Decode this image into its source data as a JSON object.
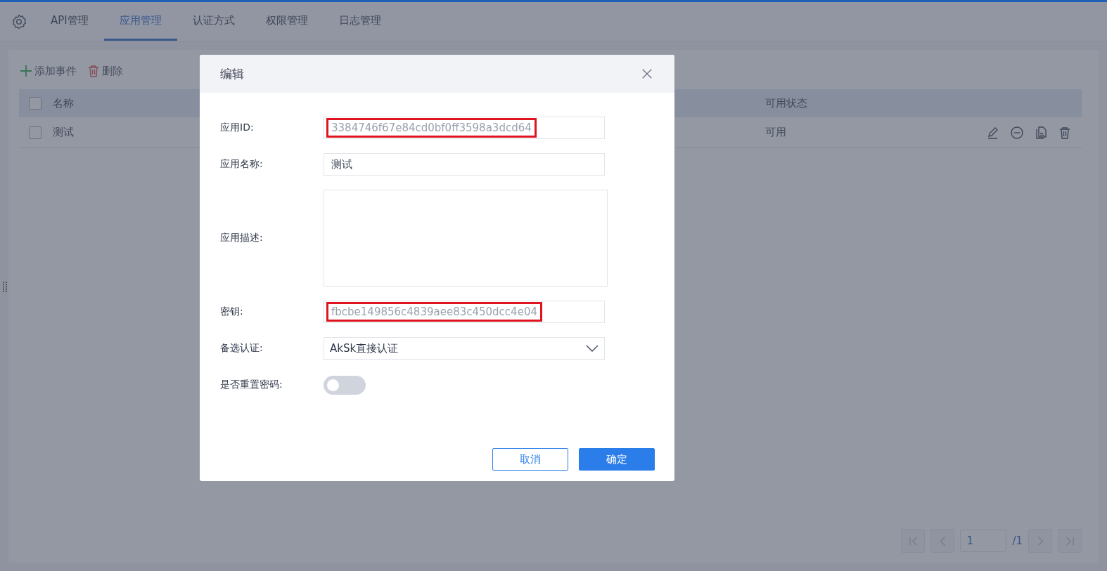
{
  "tabs": [
    {
      "label": "API管理",
      "selected": false
    },
    {
      "label": "应用管理",
      "selected": true
    },
    {
      "label": "认证方式",
      "selected": false
    },
    {
      "label": "权限管理",
      "selected": false
    },
    {
      "label": "日志管理",
      "selected": false
    }
  ],
  "toolbar": [
    {
      "kind": "add",
      "label": "添加事件"
    },
    {
      "kind": "delete",
      "label": "删除"
    }
  ],
  "table": {
    "header_checked": false,
    "columns": [
      "名称",
      "可用状态"
    ],
    "rows": [
      {
        "checked": false,
        "name": "测试",
        "status": "可用"
      }
    ]
  },
  "dialog": {
    "title": "编辑",
    "fields": [
      {
        "kind": "text",
        "label": "应用ID:",
        "value": "3384746f67e84cd0bf0ff3598a3dcd64",
        "readonly": true,
        "highlighted": true
      },
      {
        "kind": "text",
        "label": "应用名称:",
        "value": "测试",
        "readonly": false,
        "highlighted": false
      },
      {
        "kind": "textarea",
        "label": "应用描述:"
      },
      {
        "kind": "text",
        "label": "密钥:",
        "value": "fbcbe149856c4839aee83c450dcc4e04",
        "readonly": true,
        "highlighted": true
      },
      {
        "kind": "select",
        "label": "备选认证:",
        "value": "AkSk直接认证"
      },
      {
        "kind": "switch",
        "label": "是否重置密码:",
        "on": false
      }
    ],
    "buttons": [
      {
        "kind": "secondary",
        "label": "取消"
      },
      {
        "kind": "primary",
        "label": "确定"
      }
    ]
  },
  "pagination": {
    "page": "1",
    "total": "/1"
  }
}
